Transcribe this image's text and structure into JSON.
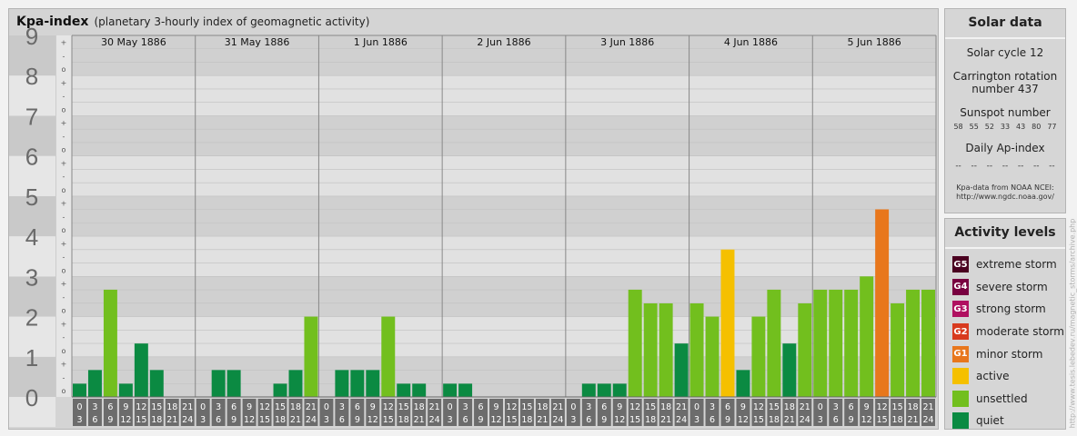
{
  "header": {
    "title": "Kpa-index",
    "subtitle": "(planetary 3-hourly index of geomagnetic activity)"
  },
  "solar": {
    "title": "Solar data",
    "cycle": "Solar cycle 12",
    "carrington_line1": "Carrington rotation",
    "carrington_line2": "number 437",
    "sunspot_label": "Sunspot number",
    "sunspots": [
      "58",
      "55",
      "52",
      "33",
      "43",
      "80",
      "77"
    ],
    "ap_label": "Daily Ap-index",
    "ap_values": [
      "--",
      "--",
      "--",
      "--",
      "--",
      "--",
      "--"
    ],
    "credit_line1": "Kpa-data from NOAA NCEI:",
    "credit_line2": "http://www.ngdc.noaa.gov/"
  },
  "activity": {
    "title": "Activity levels",
    "levels": [
      {
        "code": "G5",
        "label": "extreme storm",
        "color": "#4a0020"
      },
      {
        "code": "G4",
        "label": "severe storm",
        "color": "#780040"
      },
      {
        "code": "G3",
        "label": "strong storm",
        "color": "#b01060"
      },
      {
        "code": "G2",
        "label": "moderate storm",
        "color": "#d83a1e"
      },
      {
        "code": "G1",
        "label": "minor storm",
        "color": "#e8771c"
      },
      {
        "code": "",
        "label": "active",
        "color": "#f5c000"
      },
      {
        "code": "",
        "label": "unsettled",
        "color": "#72bf1e"
      },
      {
        "code": "",
        "label": "quiet",
        "color": "#0b8a42"
      }
    ]
  },
  "watermark": "http://www.tesis.lebedev.ru/magnetic_storms/archive.php",
  "chart_data": {
    "type": "bar",
    "title": "Kpa-index",
    "ylim": [
      0,
      9
    ],
    "yticks": [
      "0",
      "1",
      "2",
      "3",
      "4",
      "5",
      "6",
      "7",
      "8",
      "9"
    ],
    "subticks": [
      "o",
      "-",
      "+"
    ],
    "days": [
      "30 May 1886",
      "31 May 1886",
      "1 Jun 1886",
      "2 Jun 1886",
      "3 Jun 1886",
      "4 Jun 1886",
      "5 Jun 1886"
    ],
    "interval_start": [
      "0",
      "3",
      "6",
      "9",
      "12",
      "15",
      "18",
      "21"
    ],
    "interval_end": [
      "3",
      "6",
      "9",
      "12",
      "15",
      "18",
      "21",
      "24"
    ],
    "values": [
      [
        0.33,
        0.67,
        2.67,
        0.33,
        1.33,
        0.67,
        0,
        0
      ],
      [
        0,
        0.67,
        0.67,
        0,
        0,
        0.33,
        0.67,
        2
      ],
      [
        0,
        0.67,
        0.67,
        0.67,
        2,
        0.33,
        0.33,
        0
      ],
      [
        0.33,
        0.33,
        0,
        0,
        0,
        0,
        0,
        0
      ],
      [
        0,
        0.33,
        0.33,
        0.33,
        2.67,
        2.33,
        2.33,
        1.33
      ],
      [
        2.33,
        2,
        3.67,
        0.67,
        2,
        2.67,
        1.33,
        2.33
      ],
      [
        2.67,
        2.67,
        2.67,
        3,
        4.67,
        2.33,
        2.67,
        2.67
      ]
    ],
    "colors": [
      [
        "#0b8a42",
        "#0b8a42",
        "#72bf1e",
        "#0b8a42",
        "#0b8a42",
        "#0b8a42",
        "#0b8a42",
        "#0b8a42"
      ],
      [
        "#0b8a42",
        "#0b8a42",
        "#0b8a42",
        "#0b8a42",
        "#0b8a42",
        "#0b8a42",
        "#0b8a42",
        "#72bf1e"
      ],
      [
        "#0b8a42",
        "#0b8a42",
        "#0b8a42",
        "#0b8a42",
        "#72bf1e",
        "#0b8a42",
        "#0b8a42",
        "#0b8a42"
      ],
      [
        "#0b8a42",
        "#0b8a42",
        "#0b8a42",
        "#0b8a42",
        "#0b8a42",
        "#0b8a42",
        "#0b8a42",
        "#0b8a42"
      ],
      [
        "#0b8a42",
        "#0b8a42",
        "#0b8a42",
        "#0b8a42",
        "#72bf1e",
        "#72bf1e",
        "#72bf1e",
        "#0b8a42"
      ],
      [
        "#72bf1e",
        "#72bf1e",
        "#f5c000",
        "#0b8a42",
        "#72bf1e",
        "#72bf1e",
        "#0b8a42",
        "#72bf1e"
      ],
      [
        "#72bf1e",
        "#72bf1e",
        "#72bf1e",
        "#72bf1e",
        "#e8771c",
        "#72bf1e",
        "#72bf1e",
        "#72bf1e"
      ]
    ],
    "band_colors": [
      "#d0d0d0",
      "#e1e1e1"
    ]
  }
}
